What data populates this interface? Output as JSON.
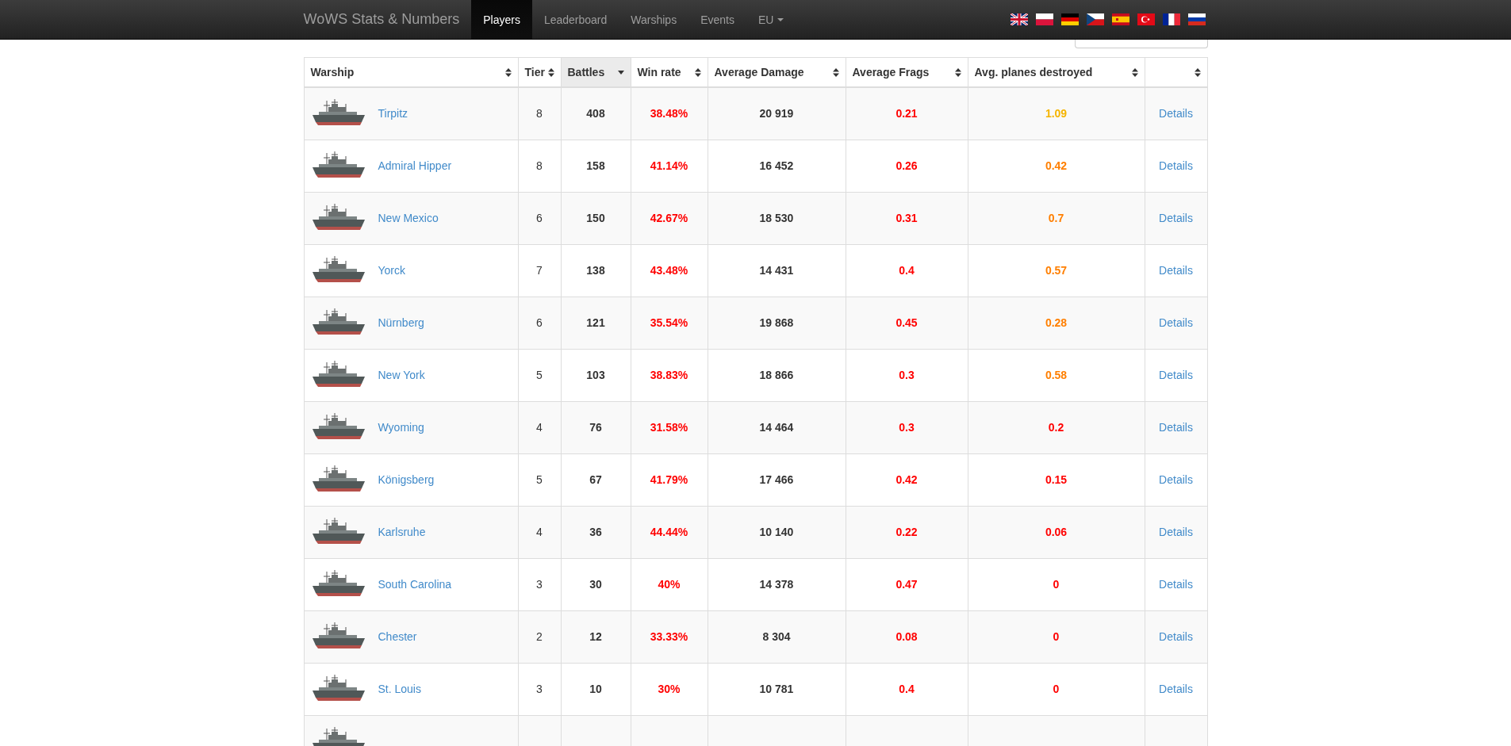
{
  "navbar": {
    "brand": "WoWS Stats & Numbers",
    "items": [
      {
        "label": "Players",
        "selected": true
      },
      {
        "label": "Leaderboard",
        "selected": false
      },
      {
        "label": "Warships",
        "selected": false
      },
      {
        "label": "Events",
        "selected": false
      }
    ],
    "region": {
      "label": "EU"
    },
    "flags": [
      {
        "kind": "uk"
      },
      {
        "kind": "pl"
      },
      {
        "kind": "de"
      },
      {
        "kind": "cz"
      },
      {
        "kind": "es"
      },
      {
        "kind": "tr"
      },
      {
        "kind": "fr"
      },
      {
        "kind": "ru"
      }
    ]
  },
  "table": {
    "columns": [
      {
        "label": "Warship",
        "selected": false
      },
      {
        "label": "Tier",
        "selected": false
      },
      {
        "label": "Battles",
        "selected": true
      },
      {
        "label": "Win rate",
        "selected": false
      },
      {
        "label": "Average Damage",
        "selected": false
      },
      {
        "label": "Average Frags",
        "selected": false
      },
      {
        "label": "Avg. planes destroyed",
        "selected": false
      },
      {
        "selected": false
      }
    ],
    "rows": [
      {
        "name": "Tirpitz",
        "tier": "8",
        "battles": "408",
        "win_rate": {
          "value": "38.48%",
          "color": "#ff0000"
        },
        "damage": "20 919",
        "frags": {
          "value": "0.21",
          "color": "#ff0000"
        },
        "planes": {
          "value": "1.09",
          "color": "#f5b400"
        },
        "link": "Details"
      },
      {
        "name": "Admiral Hipper",
        "tier": "8",
        "battles": "158",
        "win_rate": {
          "value": "41.14%",
          "color": "#ff0000"
        },
        "damage": "16 452",
        "frags": {
          "value": "0.26",
          "color": "#ff0000"
        },
        "planes": {
          "value": "0.42",
          "color": "#ff7f00"
        },
        "link": "Details"
      },
      {
        "name": "New Mexico",
        "tier": "6",
        "battles": "150",
        "win_rate": {
          "value": "42.67%",
          "color": "#ff0000"
        },
        "damage": "18 530",
        "frags": {
          "value": "0.31",
          "color": "#ff0000"
        },
        "planes": {
          "value": "0.7",
          "color": "#ff7f00"
        },
        "link": "Details"
      },
      {
        "name": "Yorck",
        "tier": "7",
        "battles": "138",
        "win_rate": {
          "value": "43.48%",
          "color": "#ff0000"
        },
        "damage": "14 431",
        "frags": {
          "value": "0.4",
          "color": "#ff0000"
        },
        "planes": {
          "value": "0.57",
          "color": "#ff7f00"
        },
        "link": "Details"
      },
      {
        "name": "Nürnberg",
        "tier": "6",
        "battles": "121",
        "win_rate": {
          "value": "35.54%",
          "color": "#ff0000"
        },
        "damage": "19 868",
        "frags": {
          "value": "0.45",
          "color": "#ff0000"
        },
        "planes": {
          "value": "0.28",
          "color": "#ff7f00"
        },
        "link": "Details"
      },
      {
        "name": "New York",
        "tier": "5",
        "battles": "103",
        "win_rate": {
          "value": "38.83%",
          "color": "#ff0000"
        },
        "damage": "18 866",
        "frags": {
          "value": "0.3",
          "color": "#ff0000"
        },
        "planes": {
          "value": "0.58",
          "color": "#ff7f00"
        },
        "link": "Details"
      },
      {
        "name": "Wyoming",
        "tier": "4",
        "battles": "76",
        "win_rate": {
          "value": "31.58%",
          "color": "#ff0000"
        },
        "damage": "14 464",
        "frags": {
          "value": "0.3",
          "color": "#ff0000"
        },
        "planes": {
          "value": "0.2",
          "color": "#ff0000"
        },
        "link": "Details"
      },
      {
        "name": "Königsberg",
        "tier": "5",
        "battles": "67",
        "win_rate": {
          "value": "41.79%",
          "color": "#ff0000"
        },
        "damage": "17 466",
        "frags": {
          "value": "0.42",
          "color": "#ff0000"
        },
        "planes": {
          "value": "0.15",
          "color": "#ff0000"
        },
        "link": "Details"
      },
      {
        "name": "Karlsruhe",
        "tier": "4",
        "battles": "36",
        "win_rate": {
          "value": "44.44%",
          "color": "#ff0000"
        },
        "damage": "10 140",
        "frags": {
          "value": "0.22",
          "color": "#ff0000"
        },
        "planes": {
          "value": "0.06",
          "color": "#ff0000"
        },
        "link": "Details"
      },
      {
        "name": "South Carolina",
        "tier": "3",
        "battles": "30",
        "win_rate": {
          "value": "40%",
          "color": "#ff0000"
        },
        "damage": "14 378",
        "frags": {
          "value": "0.47",
          "color": "#ff0000"
        },
        "planes": {
          "value": "0",
          "color": "#ff0000"
        },
        "link": "Details"
      },
      {
        "name": "Chester",
        "tier": "2",
        "battles": "12",
        "win_rate": {
          "value": "33.33%",
          "color": "#ff0000"
        },
        "damage": "8 304",
        "frags": {
          "value": "0.08",
          "color": "#ff0000"
        },
        "planes": {
          "value": "0",
          "color": "#ff0000"
        },
        "link": "Details"
      },
      {
        "name": "St. Louis",
        "tier": "3",
        "battles": "10",
        "win_rate": {
          "value": "30%",
          "color": "#ff0000"
        },
        "damage": "10 781",
        "frags": {
          "value": "0.4",
          "color": "#ff0000"
        },
        "planes": {
          "value": "0",
          "color": "#ff0000"
        },
        "link": "Details"
      },
      {}
    ]
  }
}
